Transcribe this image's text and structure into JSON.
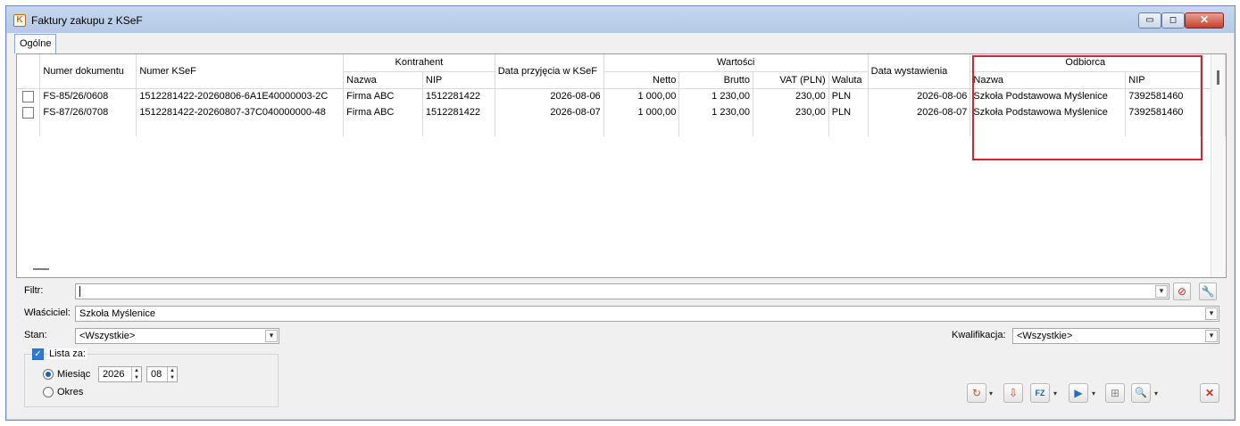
{
  "window": {
    "title": "Faktury zakupu z KSeF",
    "app_icon": "K",
    "controls": {
      "minimize": "▭",
      "maximize": "◻",
      "close": "✕"
    }
  },
  "tabs": [
    {
      "label": "Ogólne"
    }
  ],
  "grid": {
    "headers": {
      "numer_dokumentu": "Numer dokumentu",
      "numer_ksef": "Numer KSeF",
      "kontrahent": "Kontrahent",
      "kontrahent_nazwa": "Nazwa",
      "kontrahent_nip": "NIP",
      "data_przyjecia": "Data przyjęcia w KSeF",
      "wartosci": "Wartości",
      "netto": "Netto",
      "brutto": "Brutto",
      "vat": "VAT (PLN)",
      "waluta": "Waluta",
      "data_wystawienia": "Data wystawienia",
      "odbiorca": "Odbiorca",
      "odbiorca_nazwa": "Nazwa",
      "odbiorca_nip": "NIP"
    },
    "rows": [
      {
        "numer_dokumentu": "FS-85/26/0608",
        "numer_ksef": "1512281422-20260806-6A1E40000003-2C",
        "kontrahent_nazwa": "Firma ABC",
        "kontrahent_nip": "1512281422",
        "data_przyjecia": "2026-08-06",
        "netto": "1 000,00",
        "brutto": "1 230,00",
        "vat": "230,00",
        "waluta": "PLN",
        "data_wystawienia": "2026-08-06",
        "odbiorca_nazwa": "Szkoła Podstawowa Myślenice",
        "odbiorca_nip": "7392581460"
      },
      {
        "numer_dokumentu": "FS-87/26/0708",
        "numer_ksef": "1512281422-20260807-37C040000000-48",
        "kontrahent_nazwa": "Firma ABC",
        "kontrahent_nip": "1512281422",
        "data_przyjecia": "2026-08-07",
        "netto": "1 000,00",
        "brutto": "1 230,00",
        "vat": "230,00",
        "waluta": "PLN",
        "data_wystawienia": "2026-08-07",
        "odbiorca_nazwa": "Szkoła Podstawowa Myślenice",
        "odbiorca_nip": "7392581460"
      }
    ]
  },
  "filters": {
    "filtr_label": "Filtr:",
    "filtr_value": "",
    "wlasciciel_label": "Właściciel:",
    "wlasciciel_value": "Szkoła Myślenice",
    "stan_label": "Stan:",
    "stan_value": "<Wszystkie>",
    "kwalifikacja_label": "Kwalifikacja:",
    "kwalifikacja_value": "<Wszystkie>"
  },
  "lista": {
    "label": "Lista za:",
    "checked": true,
    "miesiac_label": "Miesiąc",
    "year": "2026",
    "month": "08",
    "okres_label": "Okres"
  },
  "toolbar": {
    "icons": [
      "refresh-icon",
      "document-import-icon",
      "fz-icon",
      "book-arrow-icon",
      "split-icon",
      "magnifier-icon",
      "close-icon"
    ],
    "glyphs": {
      "refresh": "↻",
      "import": "⇩",
      "fz": "FZ",
      "book": "▶",
      "split": "⊞",
      "search": "🔍",
      "close": "✕",
      "dropdown": "▾",
      "filter_clear": "⊘",
      "filter_tools": "🔧"
    }
  },
  "colors": {
    "highlight_box": "#d9232f",
    "titlebar": "#c6d7ee"
  }
}
